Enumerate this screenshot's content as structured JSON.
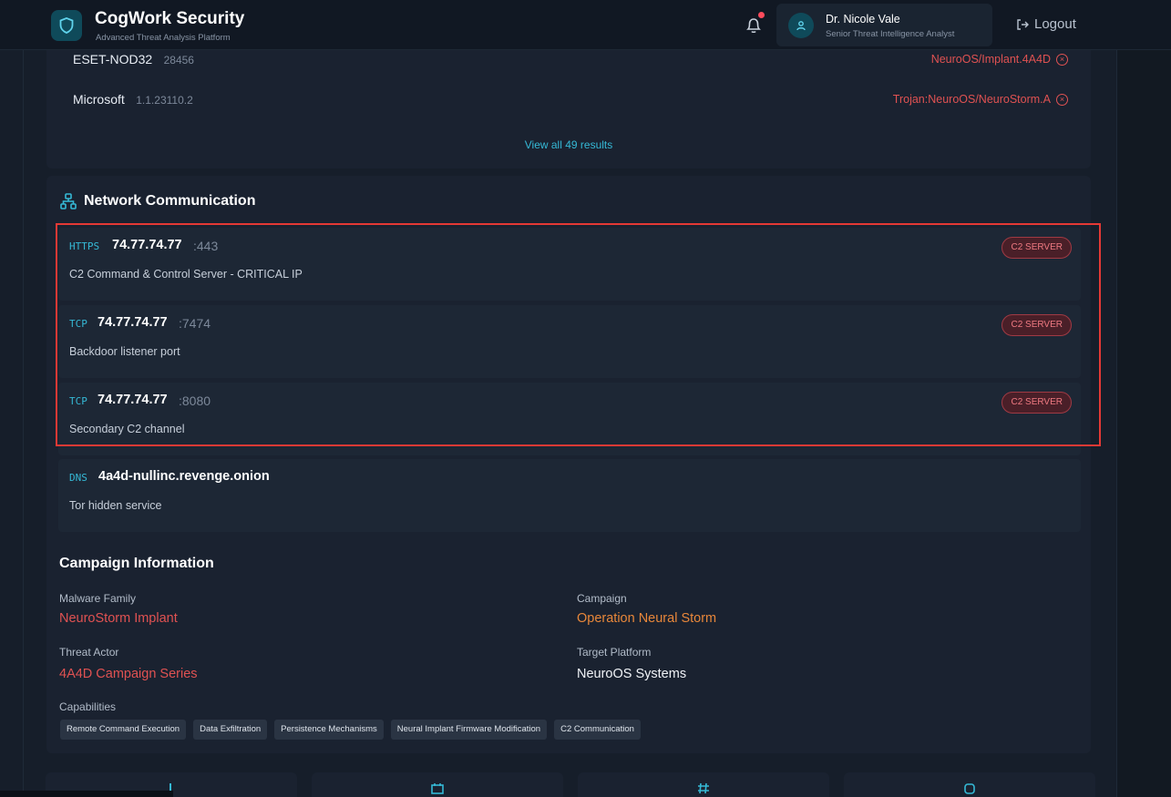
{
  "header": {
    "brand_name": "CogWork Security",
    "brand_subtitle": "Advanced Threat Analysis Platform",
    "user_name": "Dr. Nicole Vale",
    "user_role": "Senior Threat Intelligence Analyst",
    "logout_label": "Logout",
    "has_notification": true
  },
  "av_results": {
    "rows": [
      {
        "engine": "ESET-NOD32",
        "version": "28456",
        "detection": "NeuroOS/Implant.4A4D"
      },
      {
        "engine": "Microsoft",
        "version": "1.1.23110.2",
        "detection": "Trojan:NeuroOS/NeuroStorm.A"
      }
    ],
    "view_all_label": "View all 49 results"
  },
  "network": {
    "title": "Network Communication",
    "items": [
      {
        "protocol": "HTTPS",
        "address": "74.77.74.77",
        "port": ":443",
        "description": "C2 Command & Control Server - CRITICAL IP",
        "badge": "C2 SERVER"
      },
      {
        "protocol": "TCP",
        "address": "74.77.74.77",
        "port": ":7474",
        "description": "Backdoor listener port",
        "badge": "C2 SERVER"
      },
      {
        "protocol": "TCP",
        "address": "74.77.74.77",
        "port": ":8080",
        "description": "Secondary C2 channel",
        "badge": "C2 SERVER"
      },
      {
        "protocol": "DNS",
        "address": "4a4d-nullinc.revenge.onion",
        "port": "",
        "description": "Tor hidden service",
        "badge": ""
      }
    ]
  },
  "campaign": {
    "title": "Campaign Information",
    "malware_family_label": "Malware Family",
    "malware_family": "NeuroStorm Implant",
    "campaign_label": "Campaign",
    "campaign": "Operation Neural Storm",
    "threat_actor_label": "Threat Actor",
    "threat_actor": "4A4D Campaign Series",
    "target_platform_label": "Target Platform",
    "target_platform": "NeuroOS Systems",
    "capabilities_label": "Capabilities",
    "capabilities": [
      "Remote Command Execution",
      "Data Exfiltration",
      "Persistence Mechanisms",
      "Neural Implant Firmware Modification",
      "C2 Communication"
    ]
  },
  "colors": {
    "accent": "#35b9d6",
    "danger": "#e05252",
    "warning": "#e8873a",
    "highlight": "#e53935"
  },
  "icons": {
    "brand": "shield-icon",
    "notification": "bell-icon",
    "user": "user-icon",
    "logout": "logout-icon",
    "network": "network-icon",
    "detection": "x-circle-icon"
  }
}
